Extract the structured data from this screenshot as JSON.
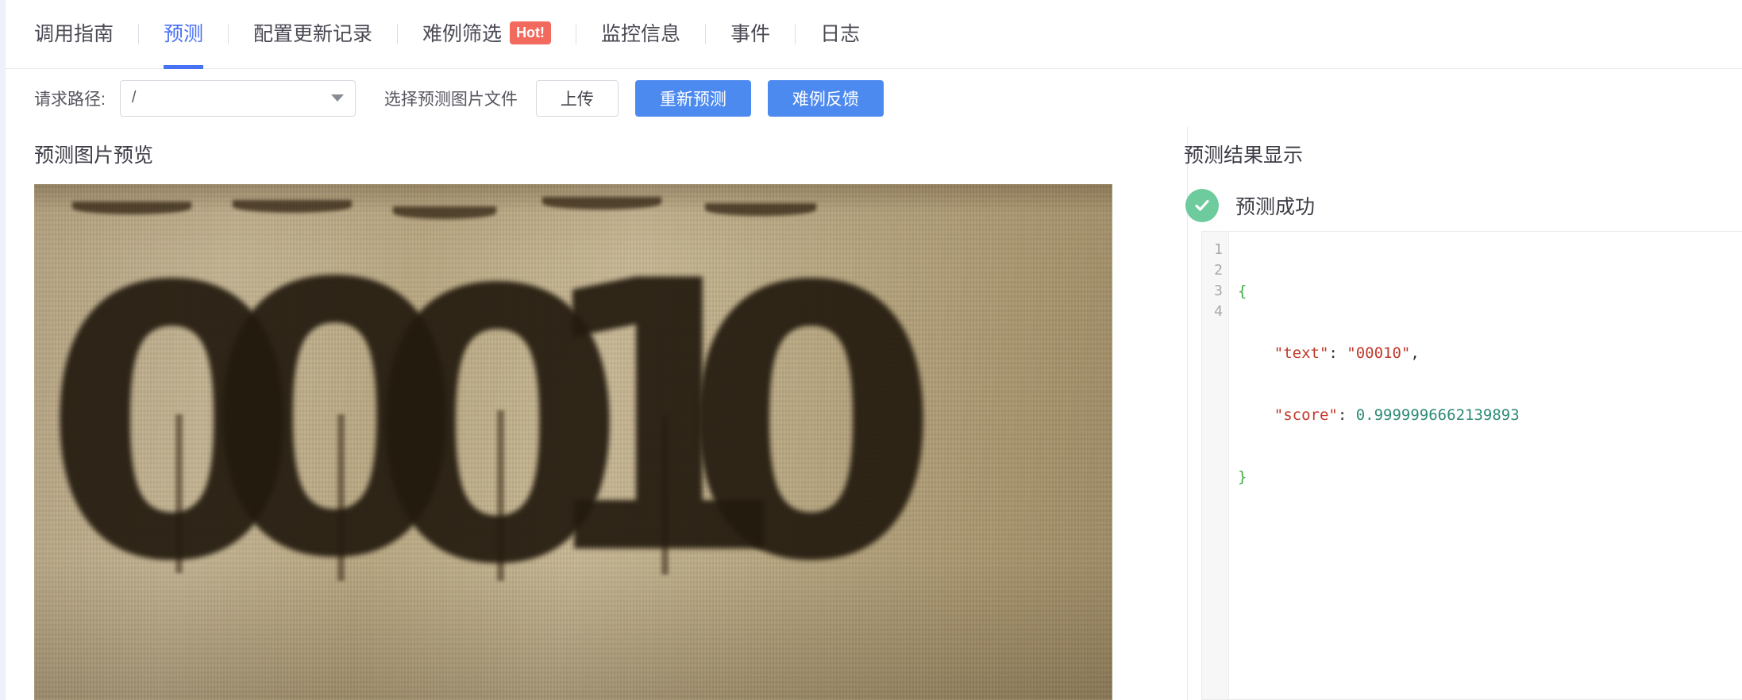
{
  "tabs": [
    {
      "label": "调用指南",
      "active": false,
      "badge": null
    },
    {
      "label": "预测",
      "active": true,
      "badge": null
    },
    {
      "label": "配置更新记录",
      "active": false,
      "badge": null
    },
    {
      "label": "难例筛选",
      "active": false,
      "badge": "Hot!"
    },
    {
      "label": "监控信息",
      "active": false,
      "badge": null
    },
    {
      "label": "事件",
      "active": false,
      "badge": null
    },
    {
      "label": "日志",
      "active": false,
      "badge": null
    }
  ],
  "toolbar": {
    "path_label": "请求路径:",
    "path_value": "/",
    "file_label": "选择预测图片文件",
    "upload_button": "上传",
    "repredict_button": "重新预测",
    "feedback_button": "难例反馈"
  },
  "left_panel": {
    "title": "预测图片预览",
    "image_alt": "00010",
    "digits": [
      "0",
      "0",
      "0",
      "1",
      "0"
    ]
  },
  "right_panel": {
    "title": "预测结果显示",
    "status_text": "预测成功",
    "status_icon": "check-circle-icon",
    "code": {
      "line1": "{",
      "line2_key": "\"text\"",
      "line2_colon": ": ",
      "line2_value": "\"00010\"",
      "line2_comma": ",",
      "line3_key": "\"score\"",
      "line3_colon": ": ",
      "line3_value": "0.9999996662139893",
      "line4": "}",
      "line_numbers": [
        "1",
        "2",
        "3",
        "4"
      ]
    }
  },
  "colors": {
    "accent_blue": "#4971f5",
    "button_blue": "#4d8af0",
    "hot_red": "#f2695e",
    "success_green": "#6dcb9d"
  }
}
